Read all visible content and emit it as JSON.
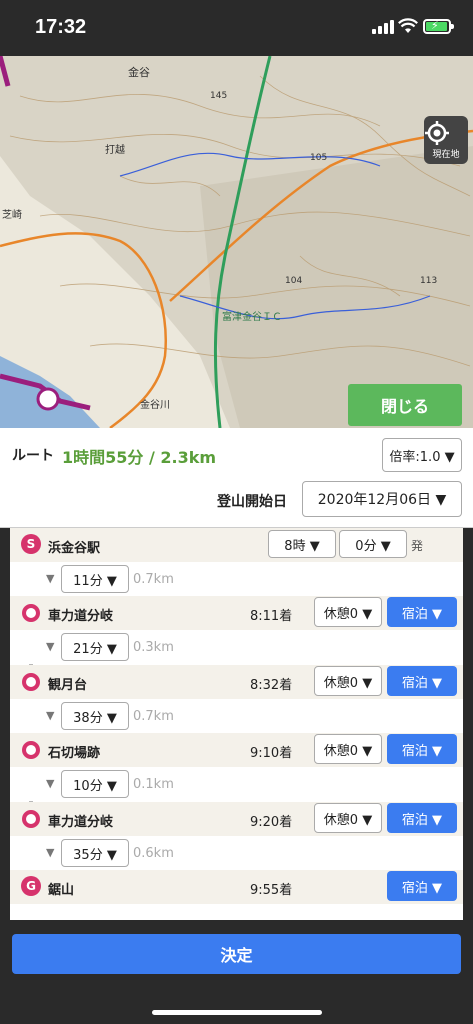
{
  "status": {
    "time": "17:32"
  },
  "map": {
    "labels": [
      "金谷",
      "145",
      "105",
      "打越",
      "芝崎",
      "104",
      "113",
      "富津金谷ＩＣ",
      "金谷川"
    ],
    "locate_label": "現在地",
    "close_label": "閉じる"
  },
  "panel": {
    "route_label": "ルート",
    "route_value": "1時間55分 / 2.3km",
    "rate_label": "倍率:1.0 ▼",
    "start_label": "登山開始日",
    "start_date": "2020年12月06日 ▼"
  },
  "start": {
    "marker": "S",
    "name": "浜金谷駅",
    "hour": "8時 ▼",
    "minute": "0分 ▼",
    "suffix": "発"
  },
  "segments": [
    {
      "duration": "11分 ▼",
      "distance": "0.7km"
    },
    {
      "duration": "21分 ▼",
      "distance": "0.3km"
    },
    {
      "duration": "38分 ▼",
      "distance": "0.7km"
    },
    {
      "duration": "10分 ▼",
      "distance": "0.1km"
    },
    {
      "duration": "35分 ▼",
      "distance": "0.6km"
    }
  ],
  "waypoints": [
    {
      "name": "車力道分岐",
      "arrival": "8:11着",
      "rest": "休憩0 ▼",
      "stay": "宿泊 ▼"
    },
    {
      "name": "観月台",
      "arrival": "8:32着",
      "rest": "休憩0 ▼",
      "stay": "宿泊 ▼"
    },
    {
      "name": "石切場跡",
      "arrival": "9:10着",
      "rest": "休憩0 ▼",
      "stay": "宿泊 ▼"
    },
    {
      "name": "車力道分岐",
      "arrival": "9:20着",
      "rest": "休憩0 ▼",
      "stay": "宿泊 ▼"
    }
  ],
  "goal": {
    "marker": "G",
    "name": "鋸山",
    "arrival": "9:55着",
    "stay": "宿泊 ▼"
  },
  "decide_label": "決定",
  "colors": {
    "accent_blue": "#3b7cf0",
    "accent_green": "#5cb85c",
    "route_pink": "#d6336c",
    "time_green": "#5a9e3a"
  }
}
